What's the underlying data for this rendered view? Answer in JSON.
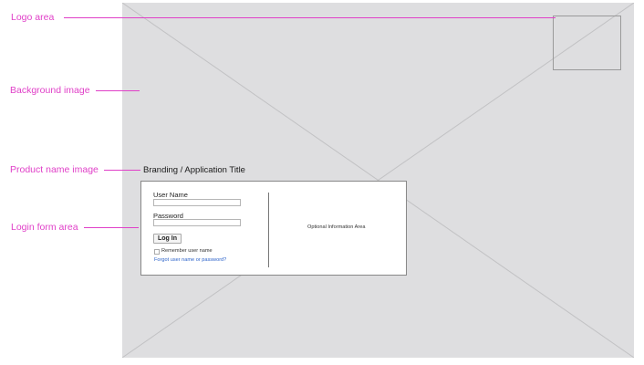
{
  "annotations": {
    "logo_area": "Logo area",
    "background_image": "Background image",
    "product_name_image": "Product name image",
    "login_form_area": "Login form area"
  },
  "branding": {
    "title": "Branding / Application Title"
  },
  "login_form": {
    "username_label": "User Name",
    "username_value": "",
    "password_label": "Password",
    "password_value": "",
    "login_button": "Log In",
    "remember_label": "Remember user name",
    "remember_checked": false,
    "forgot_link": "Forgot user name or password?"
  },
  "optional_info": "Optional Information Area",
  "colors": {
    "annotation": "#e040c8",
    "background_placeholder": "#dedee0",
    "link": "#2b62c9"
  }
}
